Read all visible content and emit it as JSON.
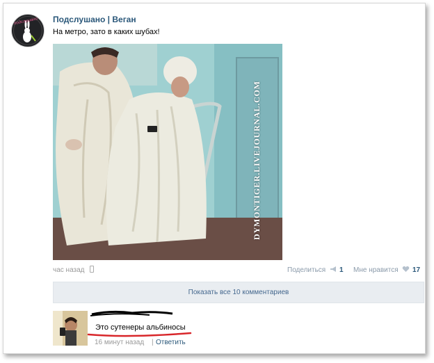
{
  "post": {
    "group_name": "Подслушано | Веган",
    "text": "На метро, зато в каких шубах!",
    "avatar_logo_text": "подслушано ВЕГАН",
    "photo_watermark": "DYMONTIGER.LIVEJOURNAL.COM",
    "time": "час назад",
    "time_icon": "phone-icon",
    "share_label": "Поделиться",
    "share_icon": "megaphone-icon",
    "share_count": "1",
    "like_label": "Мне нравится",
    "like_icon": "heart-icon",
    "like_count": "17"
  },
  "comments": {
    "show_all_label": "Показать все 10 комментариев",
    "items": [
      {
        "text": "Это сутенеры альбиносы",
        "time": "16 минут назад",
        "separator": "|",
        "reply_label": "Ответить"
      }
    ]
  },
  "colors": {
    "link": "#2b587a",
    "muted": "#999999",
    "button_bg": "#e9edf1",
    "annotation_red": "#d8262a"
  }
}
